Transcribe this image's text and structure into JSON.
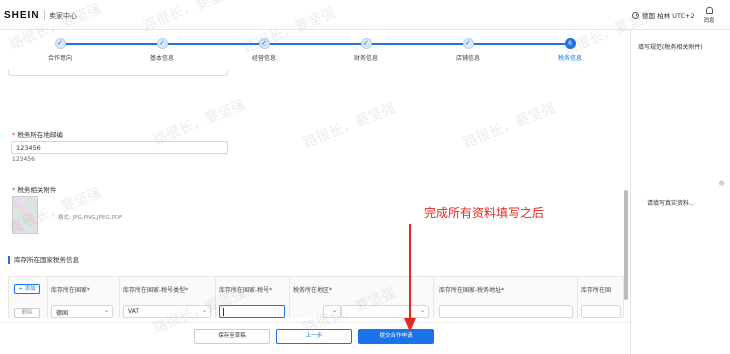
{
  "header": {
    "logo": "SHEIN",
    "seller_center": "卖家中心",
    "timezone": "德国 柏林 UTC+2",
    "messages_label": "消息"
  },
  "steps": [
    {
      "label": "合作意向",
      "marker": "✓",
      "active": false
    },
    {
      "label": "基本信息",
      "marker": "✓",
      "active": false
    },
    {
      "label": "经营信息",
      "marker": "✓",
      "active": false
    },
    {
      "label": "财务信息",
      "marker": "✓",
      "active": false
    },
    {
      "label": "店铺信息",
      "marker": "✓",
      "active": false
    },
    {
      "label": "税务信息",
      "marker": "6",
      "active": true
    }
  ],
  "form": {
    "postcode_label": "税务所在地邮编",
    "postcode_value": "123456",
    "postcode_echo": "123456",
    "attachment_label": "税务相关附件",
    "attachment_formats": "格式: JPG,PNG,JPEG,PDF"
  },
  "warehouse": {
    "section_title": "库存所在国家税务信息",
    "add_label": "+ 添加",
    "delete_label": "删除",
    "columns": [
      "库存所在国家*",
      "库存所在国家-税号类型*",
      "库存所在国家-税号*",
      "税务所在地区*",
      "库存所在国家-税务地址*",
      "库存所在国"
    ],
    "row": {
      "country": "德国",
      "tax_type": "VAT",
      "tax_number": "",
      "region": "",
      "address": "",
      "extra": ""
    }
  },
  "footer": {
    "save_draft": "保存至草稿",
    "previous": "上一步",
    "submit": "提交合作申请"
  },
  "right_panel": {
    "title": "填写规范(税务相关附件)",
    "tip": "请填写真实资料..."
  },
  "annotation": {
    "text": "完成所有资料填写之后",
    "color": "#e8281e"
  },
  "watermark": "路很长，要坚强",
  "colors": {
    "accent": "#1a73e8",
    "required": "#e53935"
  }
}
